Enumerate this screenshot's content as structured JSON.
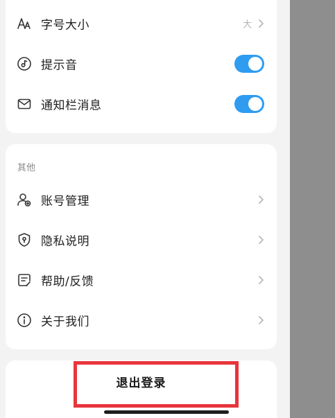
{
  "settings": {
    "font_size": {
      "label": "字号大小",
      "value": "大"
    },
    "sound": {
      "label": "提示音",
      "enabled": true
    },
    "notification": {
      "label": "通知栏消息",
      "enabled": true
    }
  },
  "other": {
    "title": "其他",
    "items": [
      {
        "label": "账号管理",
        "icon": "account-icon"
      },
      {
        "label": "隐私说明",
        "icon": "shield-icon"
      },
      {
        "label": "帮助/反馈",
        "icon": "feedback-icon"
      },
      {
        "label": "关于我们",
        "icon": "info-icon"
      }
    ]
  },
  "logout": {
    "label": "退出登录"
  },
  "colors": {
    "accent": "#2f9cf0",
    "highlight": "#e8353b",
    "overlay": "#8e8e8e"
  }
}
